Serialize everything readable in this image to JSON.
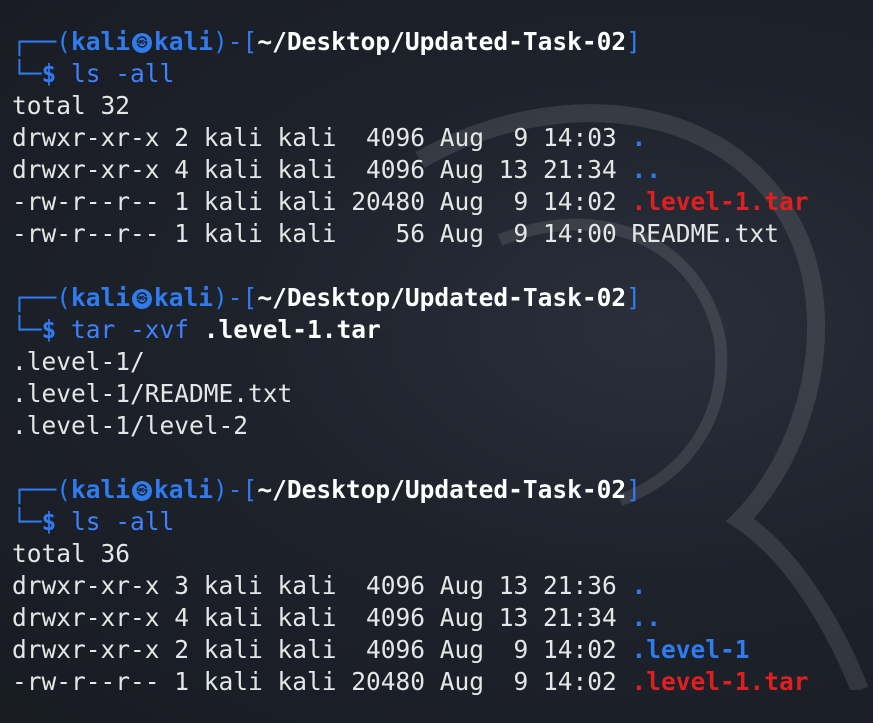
{
  "prompt": {
    "user": "kali",
    "host": "kali",
    "path": "~/Desktop/Updated-Task-02",
    "symbol": "$",
    "at_icon": "kali-skull-icon"
  },
  "blocks": [
    {
      "command": "ls -all",
      "command_arg": "",
      "output": [
        {
          "text": "total 32",
          "name": ""
        },
        {
          "text": "drwxr-xr-x 2 kali kali  4096 Aug  9 14:03 ",
          "name": ".",
          "kind": "dir"
        },
        {
          "text": "drwxr-xr-x 4 kali kali  4096 Aug 13 21:34 ",
          "name": "..",
          "kind": "dir"
        },
        {
          "text": "-rw-r--r-- 1 kali kali 20480 Aug  9 14:02 ",
          "name": ".level-1.tar",
          "kind": "archive"
        },
        {
          "text": "-rw-r--r-- 1 kali kali    56 Aug  9 14:00 ",
          "name": "README.txt",
          "kind": "file"
        }
      ]
    },
    {
      "command": "tar -xvf ",
      "command_arg": ".level-1.tar",
      "output": [
        {
          "text": ".level-1/",
          "name": ""
        },
        {
          "text": ".level-1/README.txt",
          "name": ""
        },
        {
          "text": ".level-1/level-2",
          "name": ""
        }
      ]
    },
    {
      "command": "ls -all",
      "command_arg": "",
      "output": [
        {
          "text": "total 36",
          "name": ""
        },
        {
          "text": "drwxr-xr-x 3 kali kali  4096 Aug 13 21:36 ",
          "name": ".",
          "kind": "dir"
        },
        {
          "text": "drwxr-xr-x 4 kali kali  4096 Aug 13 21:34 ",
          "name": "..",
          "kind": "dir"
        },
        {
          "text": "drwxr-xr-x 2 kali kali  4096 Aug  9 14:02 ",
          "name": ".level-1",
          "kind": "dir"
        },
        {
          "text": "-rw-r--r-- 1 kali kali 20480 Aug  9 14:02 ",
          "name": ".level-1.tar",
          "kind": "archive"
        }
      ]
    }
  ],
  "colors": {
    "background": "#1e222b",
    "prompt_blue": "#2f7bf0",
    "archive_red": "#e02020",
    "text": "#e6e6e6"
  }
}
